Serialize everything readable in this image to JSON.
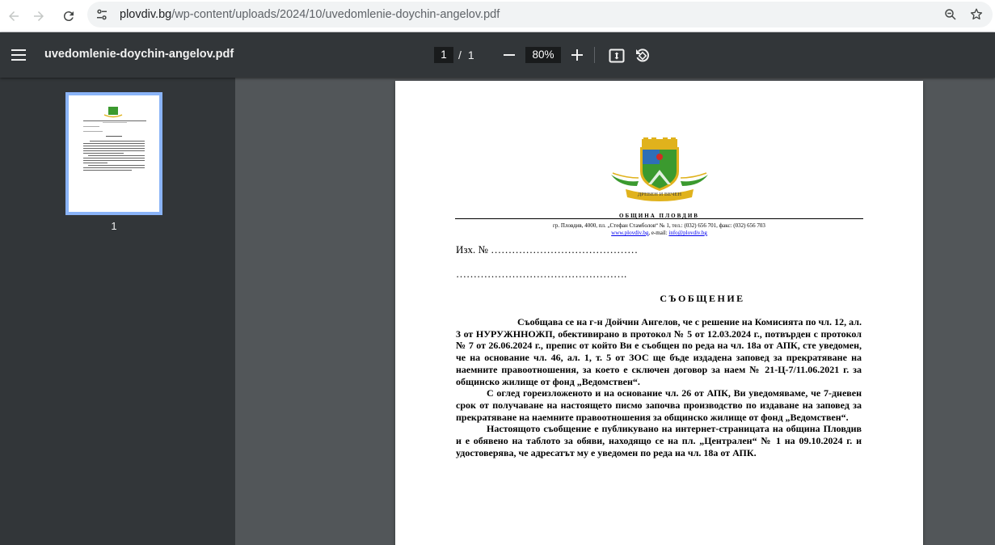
{
  "browser": {
    "url_host": "plovdiv.bg",
    "url_path": "/wp-content/uploads/2024/10/uvedomlenie-doychin-angelov.pdf"
  },
  "pdf_toolbar": {
    "title": "uvedomlenie-doychin-angelov.pdf",
    "current_page": "1",
    "page_separator": "/",
    "total_pages": "1",
    "zoom": "80%"
  },
  "sidebar": {
    "thumbnail_label": "1"
  },
  "document": {
    "crest_motto": "ДРЕВЕН И ВЕЧЕН",
    "org_name": "ОБЩИНА ПЛОВДИВ",
    "address": "гр. Пловдив, 4000, пл. „Стефан Стамболов“ № 1, тел.: (032) 656 701, факс: (032) 656 703",
    "website": "www.plovdiv.bg",
    "email_label": ", e-mail: ",
    "email": "info@plovdiv.bg",
    "ref_line": "Изх. № ……………………………………",
    "dots_line": "………………………………………….",
    "heading": "СЪОБЩЕНИЕ",
    "paragraphs": [
      "Съобщава се на г-н  Дойчин  Ангелов, че с решение на Комисията по чл. 12, ал. 3 от НУРУЖННОЖП, обективирано в протокол № 5 от 12.03.2024 г., потвърден с протокол № 7 от 26.06.2024 г.,  препис от който Ви е съобщен по реда на чл. 18а от АПК, сте уведомен, че на основание чл. 46, ал. 1, т. 5 от ЗОС ще бъде издадена заповед за прекратяване на наемните правоотношения, за което е сключен договор за наем № 21-Ц-7/11.06.2021 г. за общинско жилище от фонд „Ведомствен“.",
      "С оглед гореизложеното и на основание чл. 26 от АПК, Ви уведомяваме, че 7-дневен срок от получаване на настоящето писмо започва производство по издаване на заповед за прекратяване на наемните правоотношения за общинско жилище от фонд „Ведомствен“.",
      "Настоящото съобщение е публикувано на интернет-страницата на община Пловдив и е обявено на таблото за обяви, находящо се на пл. „Централен“ № 1 на 09.10.2024 г. и удостоверява, че адресатът му е уведомен по реда на чл. 18а от АПК."
    ]
  },
  "colors": {
    "toolbar_bg": "#323639",
    "viewer_bg": "#525659",
    "thumb_highlight": "#8ab4f8",
    "crest_green": "#3b9a2f",
    "crest_gold": "#e0b21c",
    "crest_red": "#d22b24"
  }
}
